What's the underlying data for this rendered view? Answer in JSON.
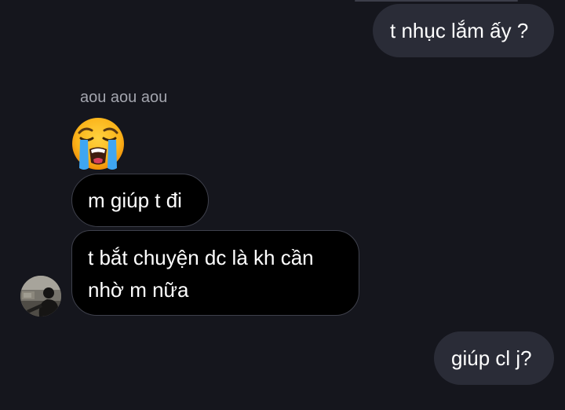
{
  "conversation": {
    "messages": [
      {
        "text": "t nhục lắm ấy ?"
      },
      {
        "sender_name": "aou aou aou"
      },
      {
        "emoji": "loudly-crying-face"
      },
      {
        "text": "m giúp t đi"
      },
      {
        "text": "t bắt chuyện dc là kh cần nhờ m nữa"
      },
      {
        "text": "giúp cl j?"
      }
    ]
  },
  "colors": {
    "background": "#15161d",
    "outgoing_bubble": "#2a2c37",
    "incoming_bubble": "#000000",
    "incoming_border": "#3f414c",
    "sender_name": "#a3a5ae",
    "text": "#ffffff"
  }
}
